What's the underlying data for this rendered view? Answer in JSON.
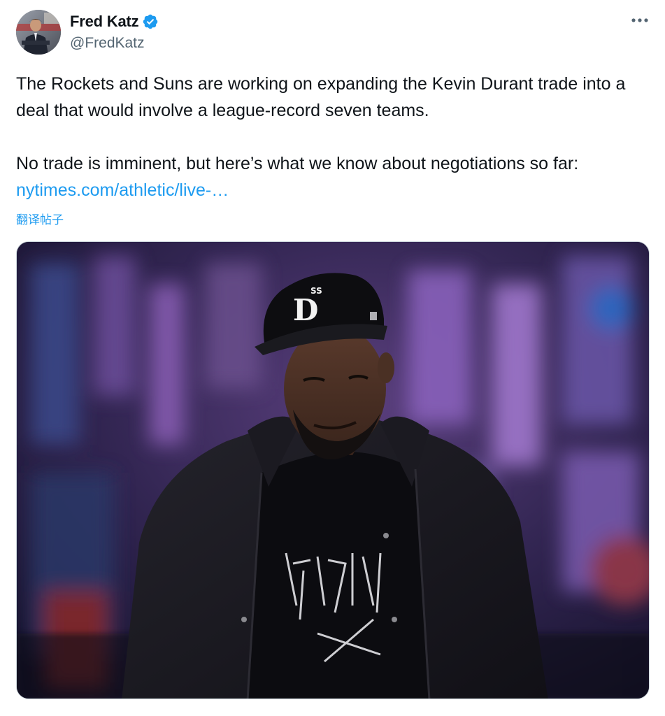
{
  "author": {
    "display_name": "Fred Katz",
    "handle": "@FredKatz",
    "verified": true,
    "verified_icon": "verified-badge-icon",
    "verified_color": "#1d9bf0"
  },
  "menu": {
    "icon": "more-horizontal-icon"
  },
  "tweet": {
    "paragraph_1": "The Rockets and Suns are working on expanding the Kevin Durant trade into a deal that would involve a league-record seven teams.",
    "paragraph_2_text": "No trade is imminent, but here’s what we know about negotiations so far: ",
    "link_text": "nytimes.com/athletic/live-…",
    "link_color": "#1d9bf0"
  },
  "translate": {
    "label": "翻译帖子"
  },
  "media": {
    "cap_logo": "D",
    "cap_superscript": "SS"
  }
}
